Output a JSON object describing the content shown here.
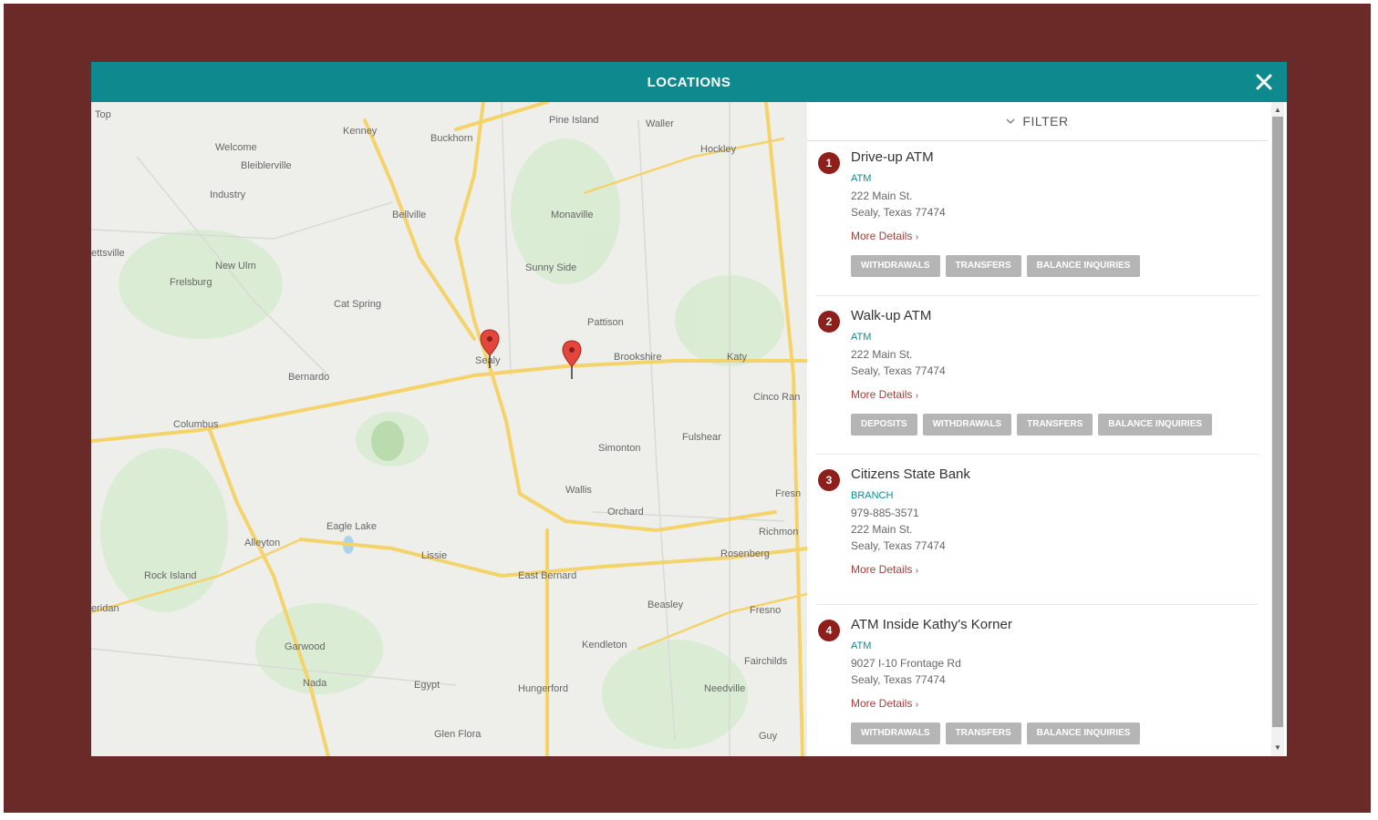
{
  "modal": {
    "title": "LOCATIONS"
  },
  "filter": {
    "label": "FILTER"
  },
  "colors": {
    "header": "#0e8a8e",
    "backdrop": "#6a2a28",
    "badge": "#8e1f1b",
    "link": "#a3413c",
    "chip": "#b5b5b5"
  },
  "map": {
    "labels": [
      "Top",
      "Kenney",
      "Buckhorn",
      "Pine Island",
      "Waller",
      "Welcome",
      "Bleiblerville",
      "Hockley",
      "Industry",
      "Bellville",
      "Monaville",
      "ettsville",
      "New Ulm",
      "Frelsburg",
      "Sunny Side",
      "Cat Spring",
      "Pattison",
      "Sealy",
      "Brookshire",
      "Katy",
      "Bernardo",
      "Cinco Ran",
      "Columbus",
      "Fulshear",
      "Simonton",
      "Wallis",
      "Fresn",
      "Orchard",
      "Eagle Lake",
      "Richmon",
      "Alleyton",
      "Lissie",
      "Rosenberg",
      "Rock Island",
      "East Bernard",
      "Beasley",
      "Fresno",
      "eridan",
      "Garwood",
      "Kendleton",
      "Fairchilds",
      "Nada",
      "Egypt",
      "Hungerford",
      "Needville",
      "Glen Flora",
      "Guy"
    ]
  },
  "locations": [
    {
      "number": "1",
      "name": "Drive-up ATM",
      "type": "ATM",
      "lines": [
        "222 Main St.",
        "Sealy, Texas 77474"
      ],
      "more": "More Details",
      "services": [
        "WITHDRAWALS",
        "TRANSFERS",
        "BALANCE INQUIRIES"
      ]
    },
    {
      "number": "2",
      "name": "Walk-up ATM",
      "type": "ATM",
      "lines": [
        "222 Main St.",
        "Sealy, Texas 77474"
      ],
      "more": "More Details",
      "services": [
        "DEPOSITS",
        "WITHDRAWALS",
        "TRANSFERS",
        "BALANCE INQUIRIES"
      ]
    },
    {
      "number": "3",
      "name": "Citizens State Bank",
      "type": "BRANCH",
      "lines": [
        "979-885-3571",
        "222 Main St.",
        "Sealy, Texas 77474"
      ],
      "more": "More Details",
      "services": []
    },
    {
      "number": "4",
      "name": "ATM Inside Kathy's Korner",
      "type": "ATM",
      "lines": [
        "9027 I-10 Frontage Rd",
        "Sealy, Texas 77474"
      ],
      "more": "More Details",
      "services": [
        "WITHDRAWALS",
        "TRANSFERS",
        "BALANCE INQUIRIES"
      ]
    }
  ]
}
